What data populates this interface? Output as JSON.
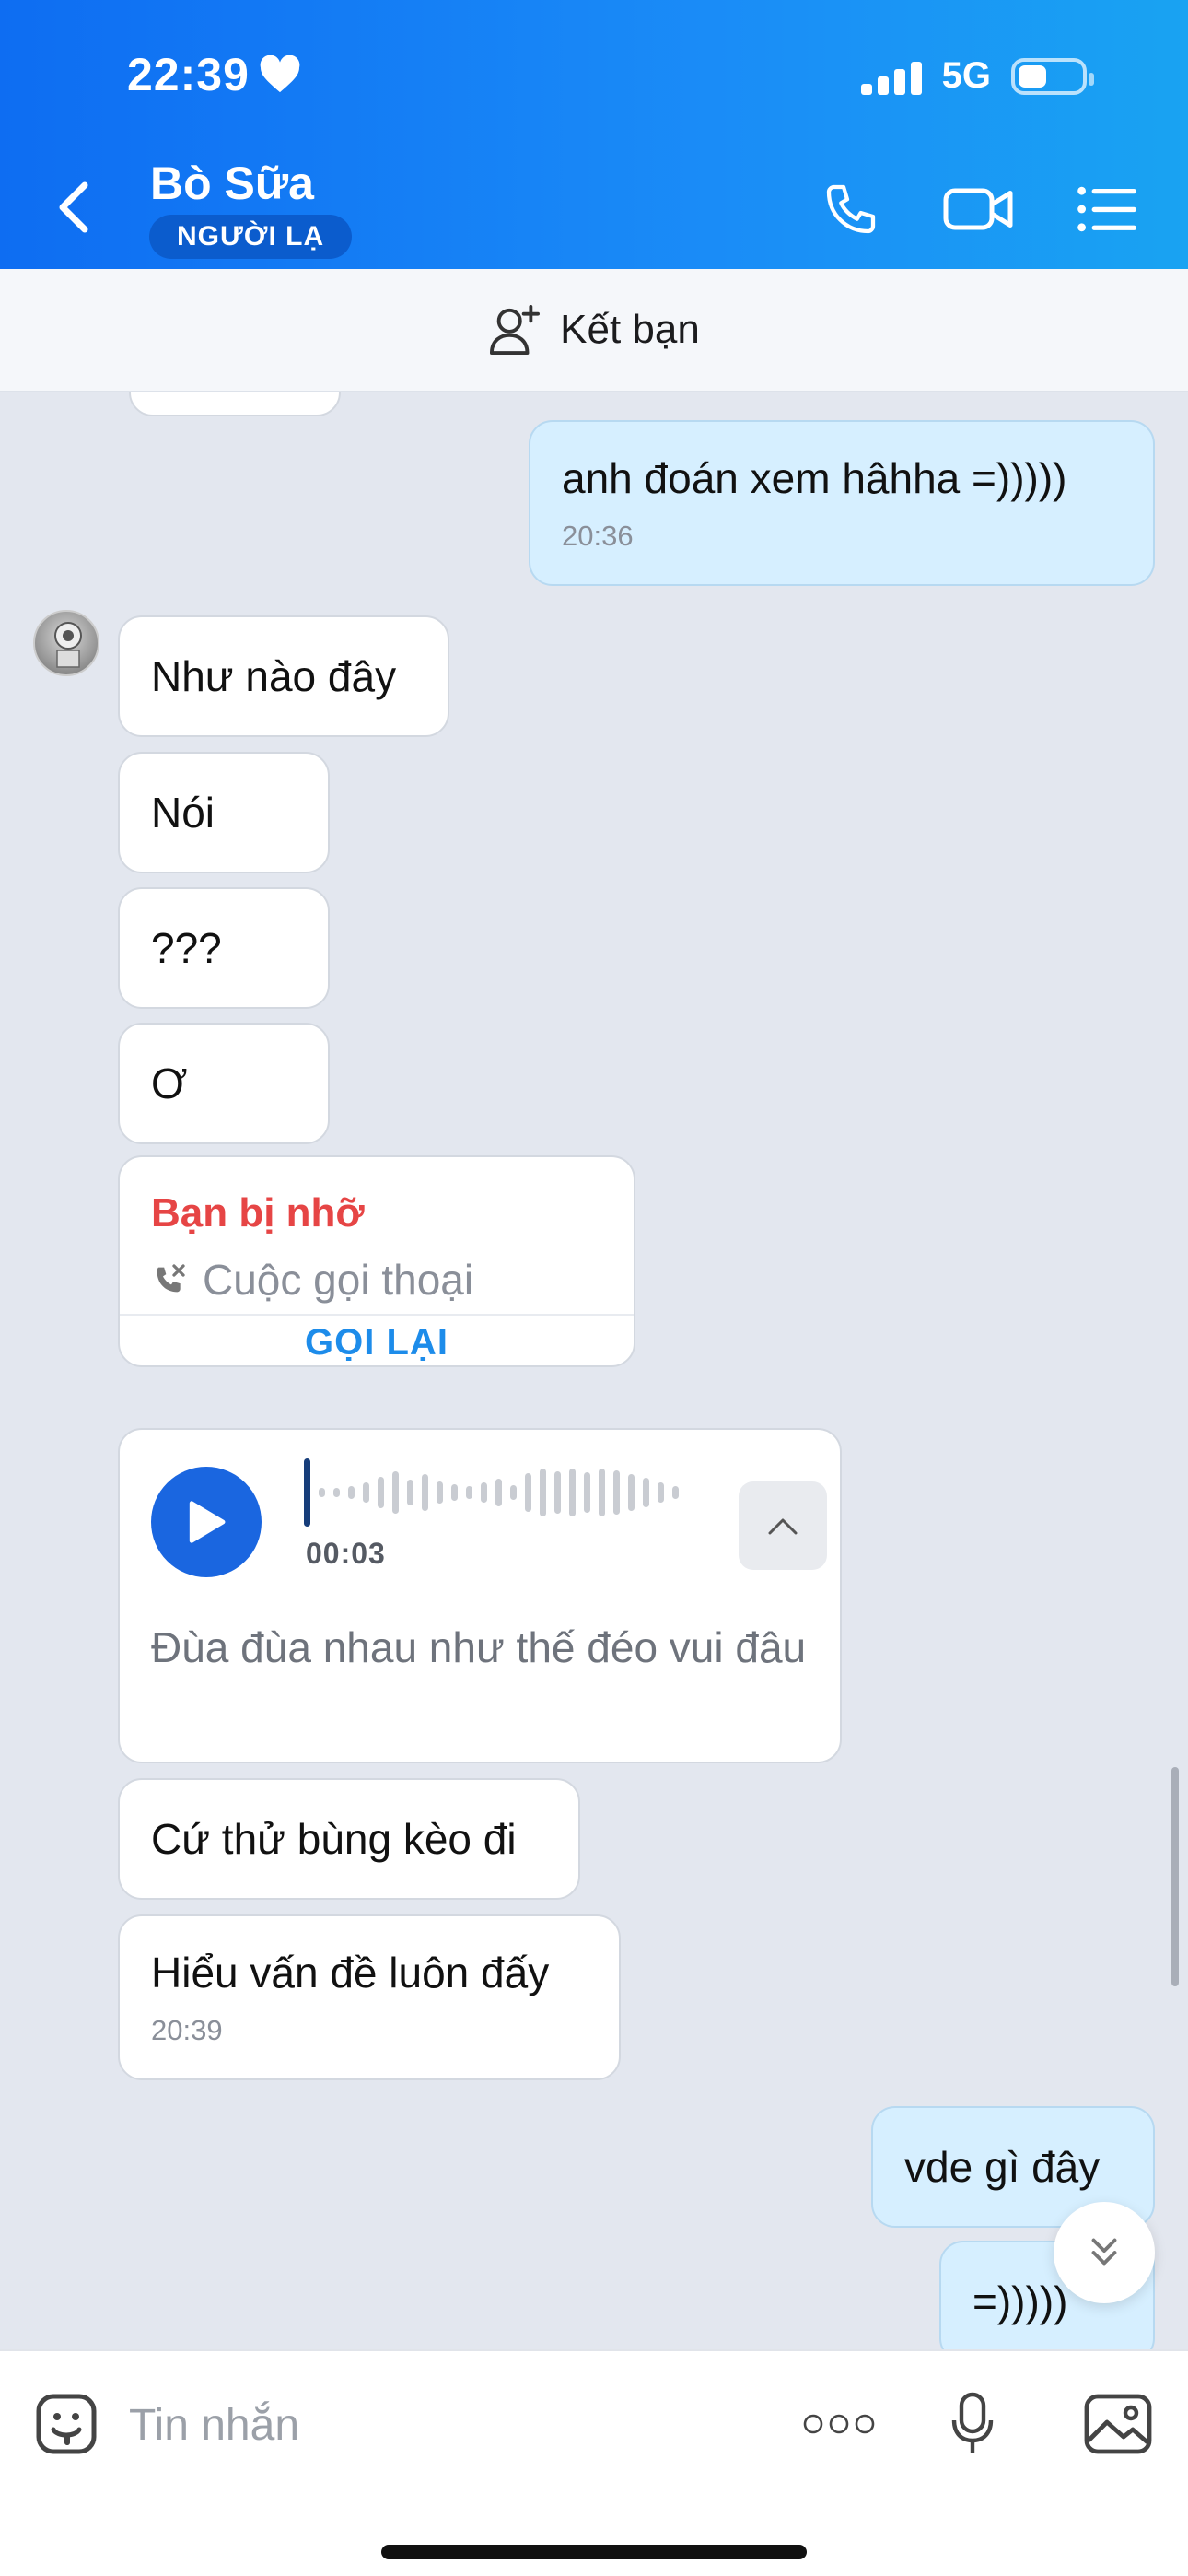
{
  "status": {
    "time": "22:39",
    "network": "5G",
    "battery_level": 0.45
  },
  "header": {
    "contact_name": "Bò Sữa",
    "badge": "NGƯỜI LẠ"
  },
  "friend_bar": {
    "label": "Kết bạn"
  },
  "messages": {
    "m1": {
      "text": "anh đoán xem hâhha =)))))",
      "time": "20:36"
    },
    "m2": {
      "text": "Như nào đây"
    },
    "m3": {
      "text": "Nói"
    },
    "m4": {
      "text": "???"
    },
    "m5": {
      "text": "Ơ"
    },
    "missed_call": {
      "title": "Bạn bị nhỡ",
      "subtitle": "Cuộc gọi thoại",
      "action": "GỌI LẠI"
    },
    "voice": {
      "duration": "00:03",
      "transcript": "Đùa đùa nhau như thế đéo vui đâu"
    },
    "m6": {
      "text": "Cứ thử bùng kèo đi"
    },
    "m7": {
      "text": "Hiểu vấn đề luôn đấy",
      "time": "20:39"
    },
    "m8": {
      "text": "vde gì đây"
    },
    "m9": {
      "text": "=)))))"
    }
  },
  "composer": {
    "placeholder": "Tin nhắn"
  },
  "colors": {
    "header_start": "#0e6df2",
    "header_end": "#19a3f2",
    "my_bubble": "#d6efff",
    "missed": "#e64545",
    "link": "#1d8cea"
  }
}
